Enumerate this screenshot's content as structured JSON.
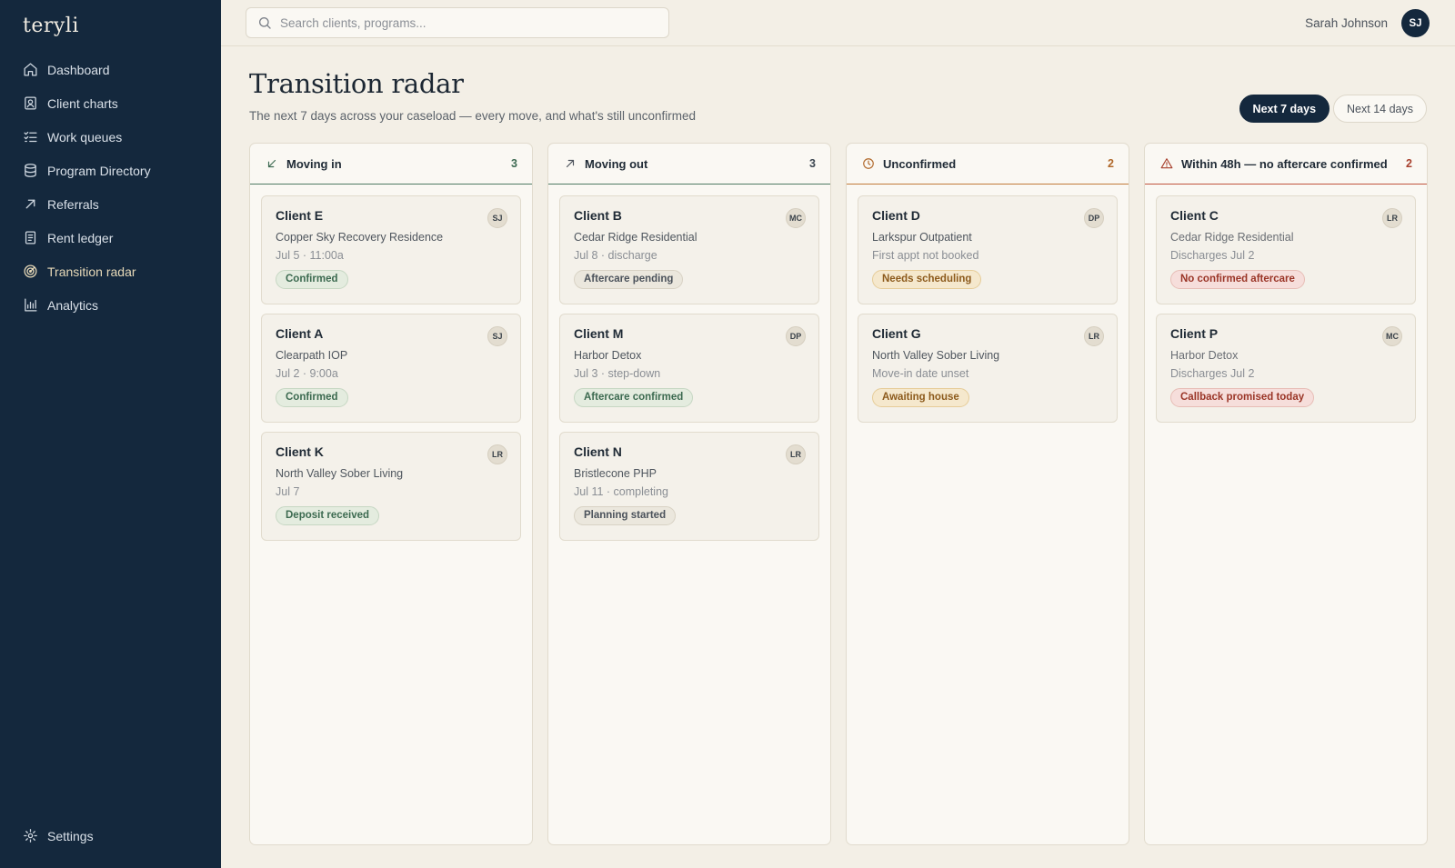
{
  "app": {
    "logo": "teryli"
  },
  "sidebar": {
    "items": [
      {
        "label": "Dashboard",
        "icon": "home-icon"
      },
      {
        "label": "Client charts",
        "icon": "chart-icon"
      },
      {
        "label": "Work queues",
        "icon": "list-check-icon"
      },
      {
        "label": "Program Directory",
        "icon": "database-icon"
      },
      {
        "label": "Referrals",
        "icon": "arrow-up-right-icon"
      },
      {
        "label": "Rent ledger",
        "icon": "ledger-icon"
      },
      {
        "label": "Transition radar",
        "icon": "radar-icon",
        "active": true
      },
      {
        "label": "Analytics",
        "icon": "bar-chart-icon"
      }
    ],
    "settings_label": "Settings"
  },
  "header": {
    "search_placeholder": "Search clients, programs...",
    "user_name": "Sarah Johnson",
    "user_initials": "SJ"
  },
  "page": {
    "title": "Transition radar",
    "subtitle": "The next 7 days across your caseload — every move, and what's still unconfirmed",
    "range_options": [
      "Next 7 days",
      "Next 14 days"
    ],
    "range_selected": "Next 7 days"
  },
  "columns": [
    {
      "title": "Moving in",
      "count": "3",
      "icon": "arrow-down-left-icon",
      "tone": "green",
      "cards": [
        {
          "name": "Client E",
          "initials": "SJ",
          "program": "Copper Sky Recovery Residence",
          "meta": "Jul 5 · 11:00a",
          "tag": "Confirmed",
          "tag_tone": "green"
        },
        {
          "name": "Client A",
          "initials": "SJ",
          "program": "Clearpath IOP",
          "meta": "Jul 2 · 9:00a",
          "tag": "Confirmed",
          "tag_tone": "green"
        },
        {
          "name": "Client K",
          "initials": "LR",
          "program": "North Valley Sober Living",
          "meta": "Jul 7",
          "tag": "Deposit received",
          "tag_tone": "green"
        }
      ]
    },
    {
      "title": "Moving out",
      "count": "3",
      "icon": "arrow-up-right-icon",
      "tone": "neutral",
      "cards": [
        {
          "name": "Client B",
          "initials": "MC",
          "program": "Cedar Ridge Residential",
          "meta": "Jul 8 · discharge",
          "tag": "Aftercare pending",
          "tag_tone": "neutral"
        },
        {
          "name": "Client M",
          "initials": "DP",
          "program": "Harbor Detox",
          "meta": "Jul 3 · step-down",
          "tag": "Aftercare confirmed",
          "tag_tone": "green"
        },
        {
          "name": "Client N",
          "initials": "LR",
          "program": "Bristlecone PHP",
          "meta": "Jul 11 · completing",
          "tag": "Planning started",
          "tag_tone": "neutral"
        }
      ]
    },
    {
      "title": "Unconfirmed",
      "count": "2",
      "icon": "clock-icon",
      "tone": "amber",
      "cards": [
        {
          "name": "Client D",
          "initials": "DP",
          "program": "Larkspur Outpatient",
          "meta": "First appt not booked",
          "tag": "Needs scheduling",
          "tag_tone": "amber"
        },
        {
          "name": "Client G",
          "initials": "LR",
          "program": "North Valley Sober Living",
          "meta": "Move-in date unset",
          "tag": "Awaiting house",
          "tag_tone": "amber"
        }
      ]
    },
    {
      "title": "Within 48h — no aftercare confirmed",
      "count": "2",
      "icon": "warning-icon",
      "tone": "red",
      "cards": [
        {
          "name": "Client C",
          "initials": "LR",
          "program": "Cedar Ridge Residential",
          "meta": "Discharges Jul 2",
          "tag": "No confirmed aftercare",
          "tag_tone": "red"
        },
        {
          "name": "Client P",
          "initials": "MC",
          "program": "Harbor Detox",
          "meta": "Discharges Jul 2",
          "tag": "Callback promised today",
          "tag_tone": "red"
        }
      ]
    }
  ],
  "colors": {
    "sidebar_bg": "#14283d",
    "page_bg": "#f3efe6",
    "green": "#3d6a52",
    "amber": "#b0682a",
    "red": "#a8412e"
  }
}
